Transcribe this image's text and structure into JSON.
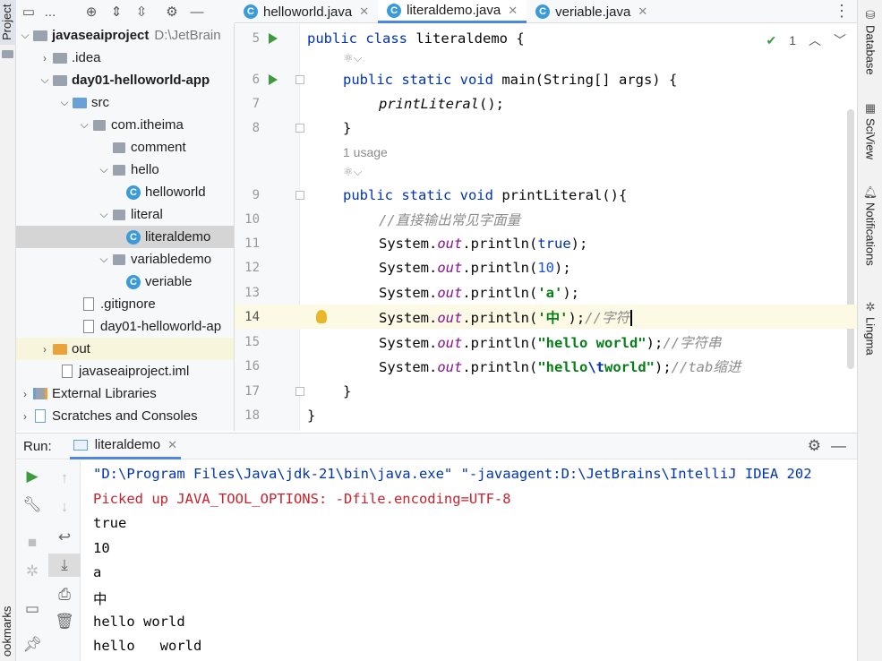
{
  "left_strip": {
    "project_label": "Project",
    "bookmarks_label": "ookmarks"
  },
  "right_strip": [
    {
      "icon": "database-icon",
      "label": "Database"
    },
    {
      "icon": "sciview-icon",
      "label": "SciView"
    },
    {
      "icon": "bell-icon",
      "label": "Notifications"
    },
    {
      "icon": "lingma-icon",
      "label": "Lingma"
    }
  ],
  "project_toolbar": {
    "view_label": "..."
  },
  "tree": [
    {
      "label": "javaseaiproject",
      "sub": "D:\\JetBrain",
      "icon": "folder-icon",
      "bold": true,
      "arrow": "down"
    },
    {
      "label": ".idea",
      "icon": "folder-icon",
      "arrow": "right"
    },
    {
      "label": "day01-helloworld-app",
      "icon": "module-icon",
      "bold": true,
      "arrow": "down"
    },
    {
      "label": "src",
      "icon": "source-folder-icon",
      "arrow": "down"
    },
    {
      "label": "com.itheima",
      "icon": "package-icon",
      "arrow": "down"
    },
    {
      "label": "comment",
      "icon": "package-icon",
      "arrow": ""
    },
    {
      "label": "hello",
      "icon": "package-icon",
      "arrow": "down"
    },
    {
      "label": "helloworld",
      "icon": "class-icon",
      "arrow": ""
    },
    {
      "label": "literal",
      "icon": "package-icon",
      "arrow": "down"
    },
    {
      "label": "literaldemo",
      "icon": "class-icon",
      "arrow": "",
      "selected": true
    },
    {
      "label": "variabledemo",
      "icon": "package-icon",
      "arrow": "down"
    },
    {
      "label": "veriable",
      "icon": "class-icon",
      "arrow": ""
    },
    {
      "label": ".gitignore",
      "icon": "file-icon",
      "arrow": ""
    },
    {
      "label": "day01-helloworld-ap",
      "icon": "file-icon",
      "arrow": ""
    },
    {
      "label": "out",
      "icon": "folder-orange-icon",
      "arrow": "right",
      "highlight": true
    },
    {
      "label": "javaseaiproject.iml",
      "icon": "file-icon",
      "arrow": ""
    },
    {
      "label": "External Libraries",
      "icon": "library-icon",
      "arrow": "right"
    },
    {
      "label": "Scratches and Consoles",
      "icon": "scratch-icon",
      "arrow": "right"
    }
  ],
  "tabs": [
    {
      "label": "helloworld.java",
      "active": false
    },
    {
      "label": "literaldemo.java",
      "active": true
    },
    {
      "label": "veriable.java",
      "active": false
    }
  ],
  "inspection": {
    "count": "1"
  },
  "editor": {
    "line_numbers": [
      "5",
      "6",
      "7",
      "8",
      "9",
      "10",
      "11",
      "12",
      "13",
      "14",
      "15",
      "16",
      "17",
      "18"
    ],
    "usage_hint": "1 usage",
    "code": {
      "l5_kw": "public class ",
      "l5_name": "literaldemo",
      "l5_rest": " {",
      "l6_kw": "public static void ",
      "l6_rest": "main(String[] args) {",
      "l7_call": "printLiteral",
      "l7_rest": "();",
      "l8": "}",
      "l9_kw": "public static void ",
      "l9_rest": "printLiteral(){",
      "l10_comment": "//直接输出常见字面量",
      "sys": "System.",
      "out": "out",
      "println": ".println(",
      "l11_val": "true",
      "l12_val": "10",
      "l13_val": "'a'",
      "l14_val": "'中'",
      "l14_comment": "//字符",
      "l15_val": "\"hello world\"",
      "l15_comment": "//字符串",
      "l16_val_a": "\"hello",
      "l16_esc": "\\t",
      "l16_val_b": "world\"",
      "l16_comment": "//tab缩进",
      "close_paren": ");",
      "l17": "}",
      "l18": "}"
    }
  },
  "run": {
    "title": "Run:",
    "tab_label": "literaldemo",
    "console": [
      "\"D:\\Program Files\\Java\\jdk-21\\bin\\java.exe\" \"-javaagent:D:\\JetBrains\\IntelliJ IDEA 202",
      "Picked up JAVA_TOOL_OPTIONS: -Dfile.encoding=UTF-8",
      "true",
      "10",
      "a",
      "中",
      "hello world",
      "hello\tworld"
    ]
  }
}
